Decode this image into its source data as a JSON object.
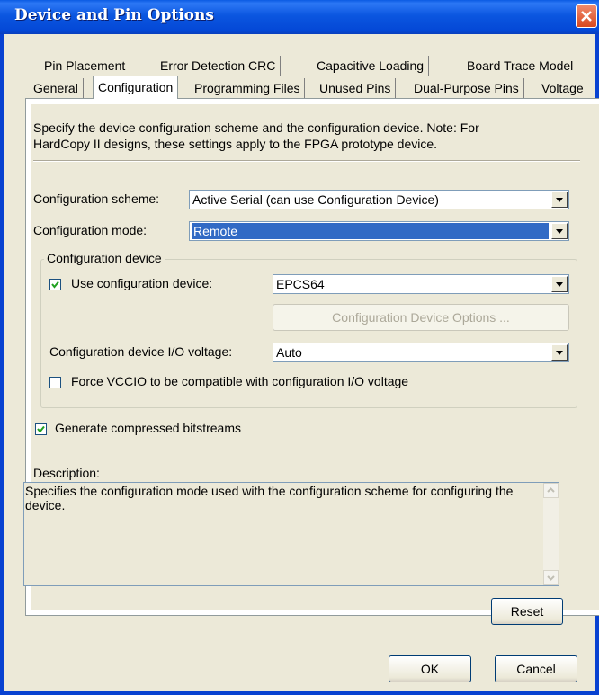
{
  "window": {
    "title": "Device and Pin Options"
  },
  "tabs": {
    "row1": [
      "Pin Placement",
      "Error Detection CRC",
      "Capacitive Loading",
      "Board Trace Model"
    ],
    "row2": [
      "General",
      "Configuration",
      "Programming Files",
      "Unused Pins",
      "Dual-Purpose Pins",
      "Voltage"
    ],
    "active": "Configuration"
  },
  "intro": {
    "line1": "Specify the device configuration scheme and the configuration device. Note: For",
    "line2": "HardCopy II designs, these settings apply to the FPGA prototype device."
  },
  "scheme": {
    "label": "Configuration scheme:",
    "value": "Active Serial (can use Configuration Device)"
  },
  "mode": {
    "label": "Configuration mode:",
    "value": "Remote"
  },
  "config_device": {
    "group_label": "Configuration device",
    "use_label": "Use configuration device:",
    "use_checked": true,
    "device_value": "EPCS64",
    "options_button": "Configuration Device Options ...",
    "io_voltage_label": "Configuration device I/O voltage:",
    "io_voltage_value": "Auto",
    "force_label": "Force VCCIO to be compatible with configuration I/O voltage",
    "force_checked": false
  },
  "compressed": {
    "label": "Generate compressed bitstreams",
    "checked": true
  },
  "description": {
    "label": "Description:",
    "text": "Specifies the configuration mode used with the configuration scheme for configuring the device."
  },
  "buttons": {
    "reset": "Reset",
    "ok": "OK",
    "cancel": "Cancel"
  },
  "colors": {
    "titlebar": "#0a5be3",
    "selection": "#316ac5",
    "face": "#ece9d8"
  }
}
